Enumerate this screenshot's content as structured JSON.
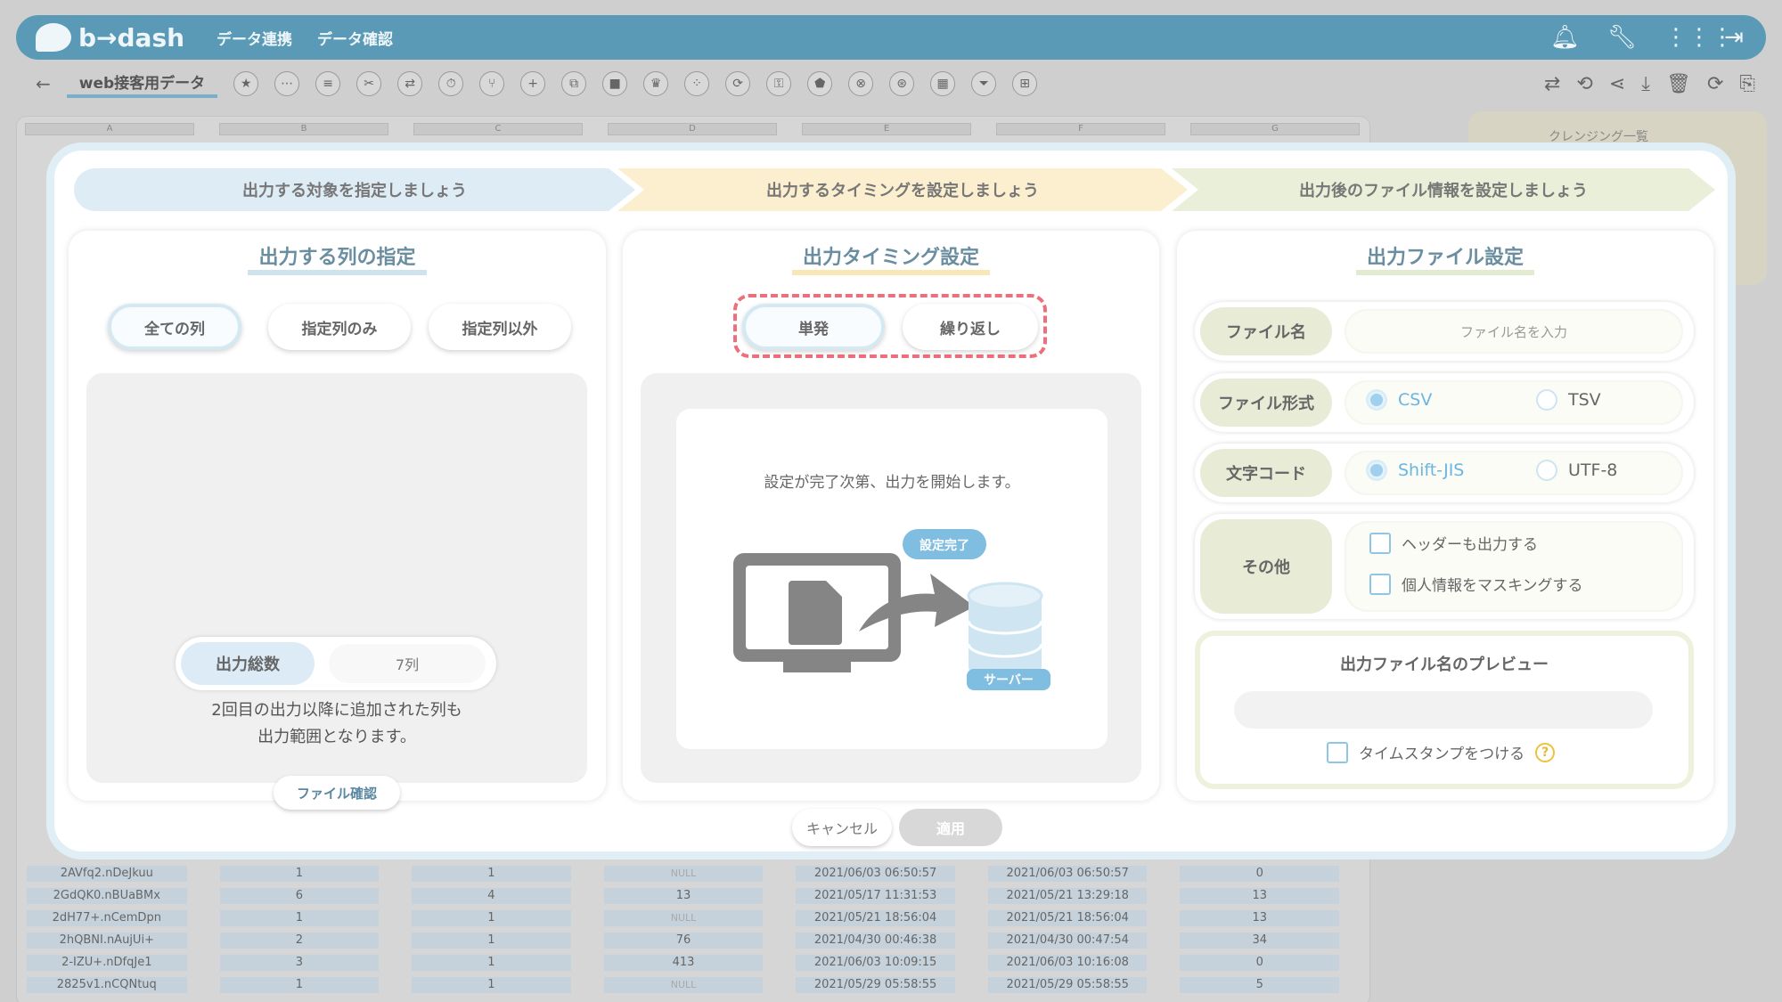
{
  "app": {
    "logo_text": "b→dash",
    "nav": [
      "データ連携",
      "データ確認"
    ],
    "icons": [
      "bell-icon",
      "wrench-icon",
      "grid-icon",
      "logout-icon"
    ]
  },
  "toolbar": {
    "back_icon": "←",
    "sheet_title": "web接客用データ",
    "tools": [
      "★",
      "⋯",
      "≡",
      "✂",
      "⇄",
      "⏱",
      "⑂",
      "+",
      "⧉",
      "■",
      "♛",
      "⁘",
      "⟳",
      "⚿",
      "⬟",
      "⊗",
      "⊛",
      "▦",
      "⏷",
      "⊞"
    ],
    "right_tools": [
      "⇄",
      "⟲",
      "⋖",
      "⤓",
      "🗑",
      "⟳",
      "⎘"
    ]
  },
  "background": {
    "columns": [
      "A",
      "B",
      "C",
      "D",
      "E",
      "F",
      "G"
    ],
    "cleansing_title": "クレンジング一覧",
    "rows": [
      [
        "2AVfq2.nDeJkuu",
        "1",
        "1",
        "NULL",
        "2021/06/03 06:50:57",
        "2021/06/03 06:50:57",
        "0"
      ],
      [
        "2GdQK0.nBUaBMx",
        "6",
        "4",
        "13",
        "2021/05/17 11:31:53",
        "2021/05/21 13:29:18",
        "13"
      ],
      [
        "2dH77+.nCemDpn",
        "1",
        "1",
        "NULL",
        "2021/05/21 18:56:04",
        "2021/05/21 18:56:04",
        "13"
      ],
      [
        "2hQBNI.nAujUi+",
        "2",
        "1",
        "76",
        "2021/04/30 00:46:38",
        "2021/04/30 00:47:54",
        "34"
      ],
      [
        "2-IZU+.nDfqJe1",
        "3",
        "1",
        "413",
        "2021/06/03 10:09:15",
        "2021/06/03 10:16:08",
        "0"
      ],
      [
        "2825v1.nCQNtuq",
        "1",
        "1",
        "NULL",
        "2021/05/29 05:58:55",
        "2021/05/29 05:58:55",
        "5"
      ]
    ]
  },
  "steps": [
    "出力する対象を指定しましょう",
    "出力するタイミングを設定しましょう",
    "出力後のファイル情報を設定しましょう"
  ],
  "columns_panel": {
    "title": "出力する列の指定",
    "options": [
      "全ての列",
      "指定列のみ",
      "指定列以外"
    ],
    "selected": "全ての列",
    "total_label": "出力総数",
    "total_value": "7列",
    "note_line1": "2回目の出力以降に追加された列も",
    "note_line2": "出力範囲となります。",
    "file_check_button": "ファイル確認"
  },
  "timing_panel": {
    "title": "出力タイミング設定",
    "options": [
      "単発",
      "繰り返し"
    ],
    "selected": "単発",
    "description": "設定が完了次第、出力を開始します。",
    "badge_done": "設定完了",
    "badge_server": "サーバー"
  },
  "file_panel": {
    "title": "出力ファイル設定",
    "filename_label": "ファイル名",
    "filename_placeholder": "ファイル名を入力",
    "format_label": "ファイル形式",
    "format_options": [
      "CSV",
      "TSV"
    ],
    "format_selected": "CSV",
    "encoding_label": "文字コード",
    "encoding_options": [
      "Shift-JIS",
      "UTF-8"
    ],
    "encoding_selected": "Shift-JIS",
    "other_label": "その他",
    "other_checks": [
      "ヘッダーも出力する",
      "個人情報をマスキングする"
    ],
    "preview_title": "出力ファイル名のプレビュー",
    "preview_value": "",
    "timestamp_label": "タイムスタンプをつける",
    "help_icon": "?"
  },
  "footer": {
    "cancel": "キャンセル",
    "apply": "適用"
  },
  "colors": {
    "header_blue": "#5b9ab7",
    "accent_blue": "#6cb5e0",
    "dashed_red": "#ec6f7b"
  }
}
